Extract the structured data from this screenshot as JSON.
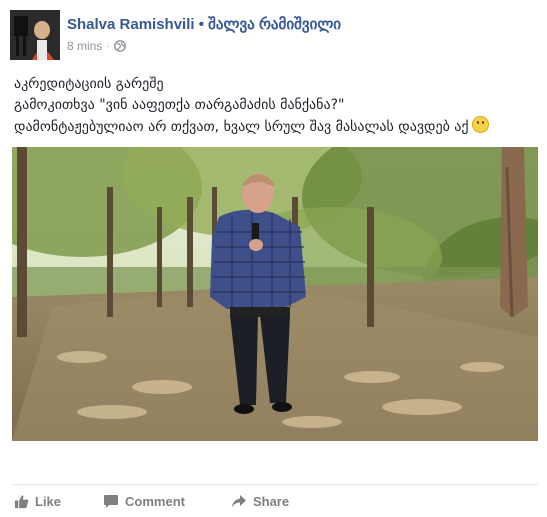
{
  "post": {
    "author": "Shalva Ramishvili • შალვა რამიშვილი",
    "timestamp": "8 mins",
    "separator": "·",
    "privacy_icon": "globe-icon",
    "text_lines": [
      "აკრედიტაციის გარეშე",
      "გამოკითხვა \"ვინ ააფეთქა თარგამაძის მანქანა?\"",
      "დამონტაჟებულიაო არ თქვათ, ხვალ სრულ შავ მასალას დავდებ აქ"
    ],
    "emoji": "smiley-emoji"
  },
  "actions": {
    "like_label": "Like",
    "comment_label": "Comment",
    "share_label": "Share"
  },
  "colors": {
    "author": "#365899",
    "meta": "#90949c",
    "action": "#7f7f7f"
  }
}
